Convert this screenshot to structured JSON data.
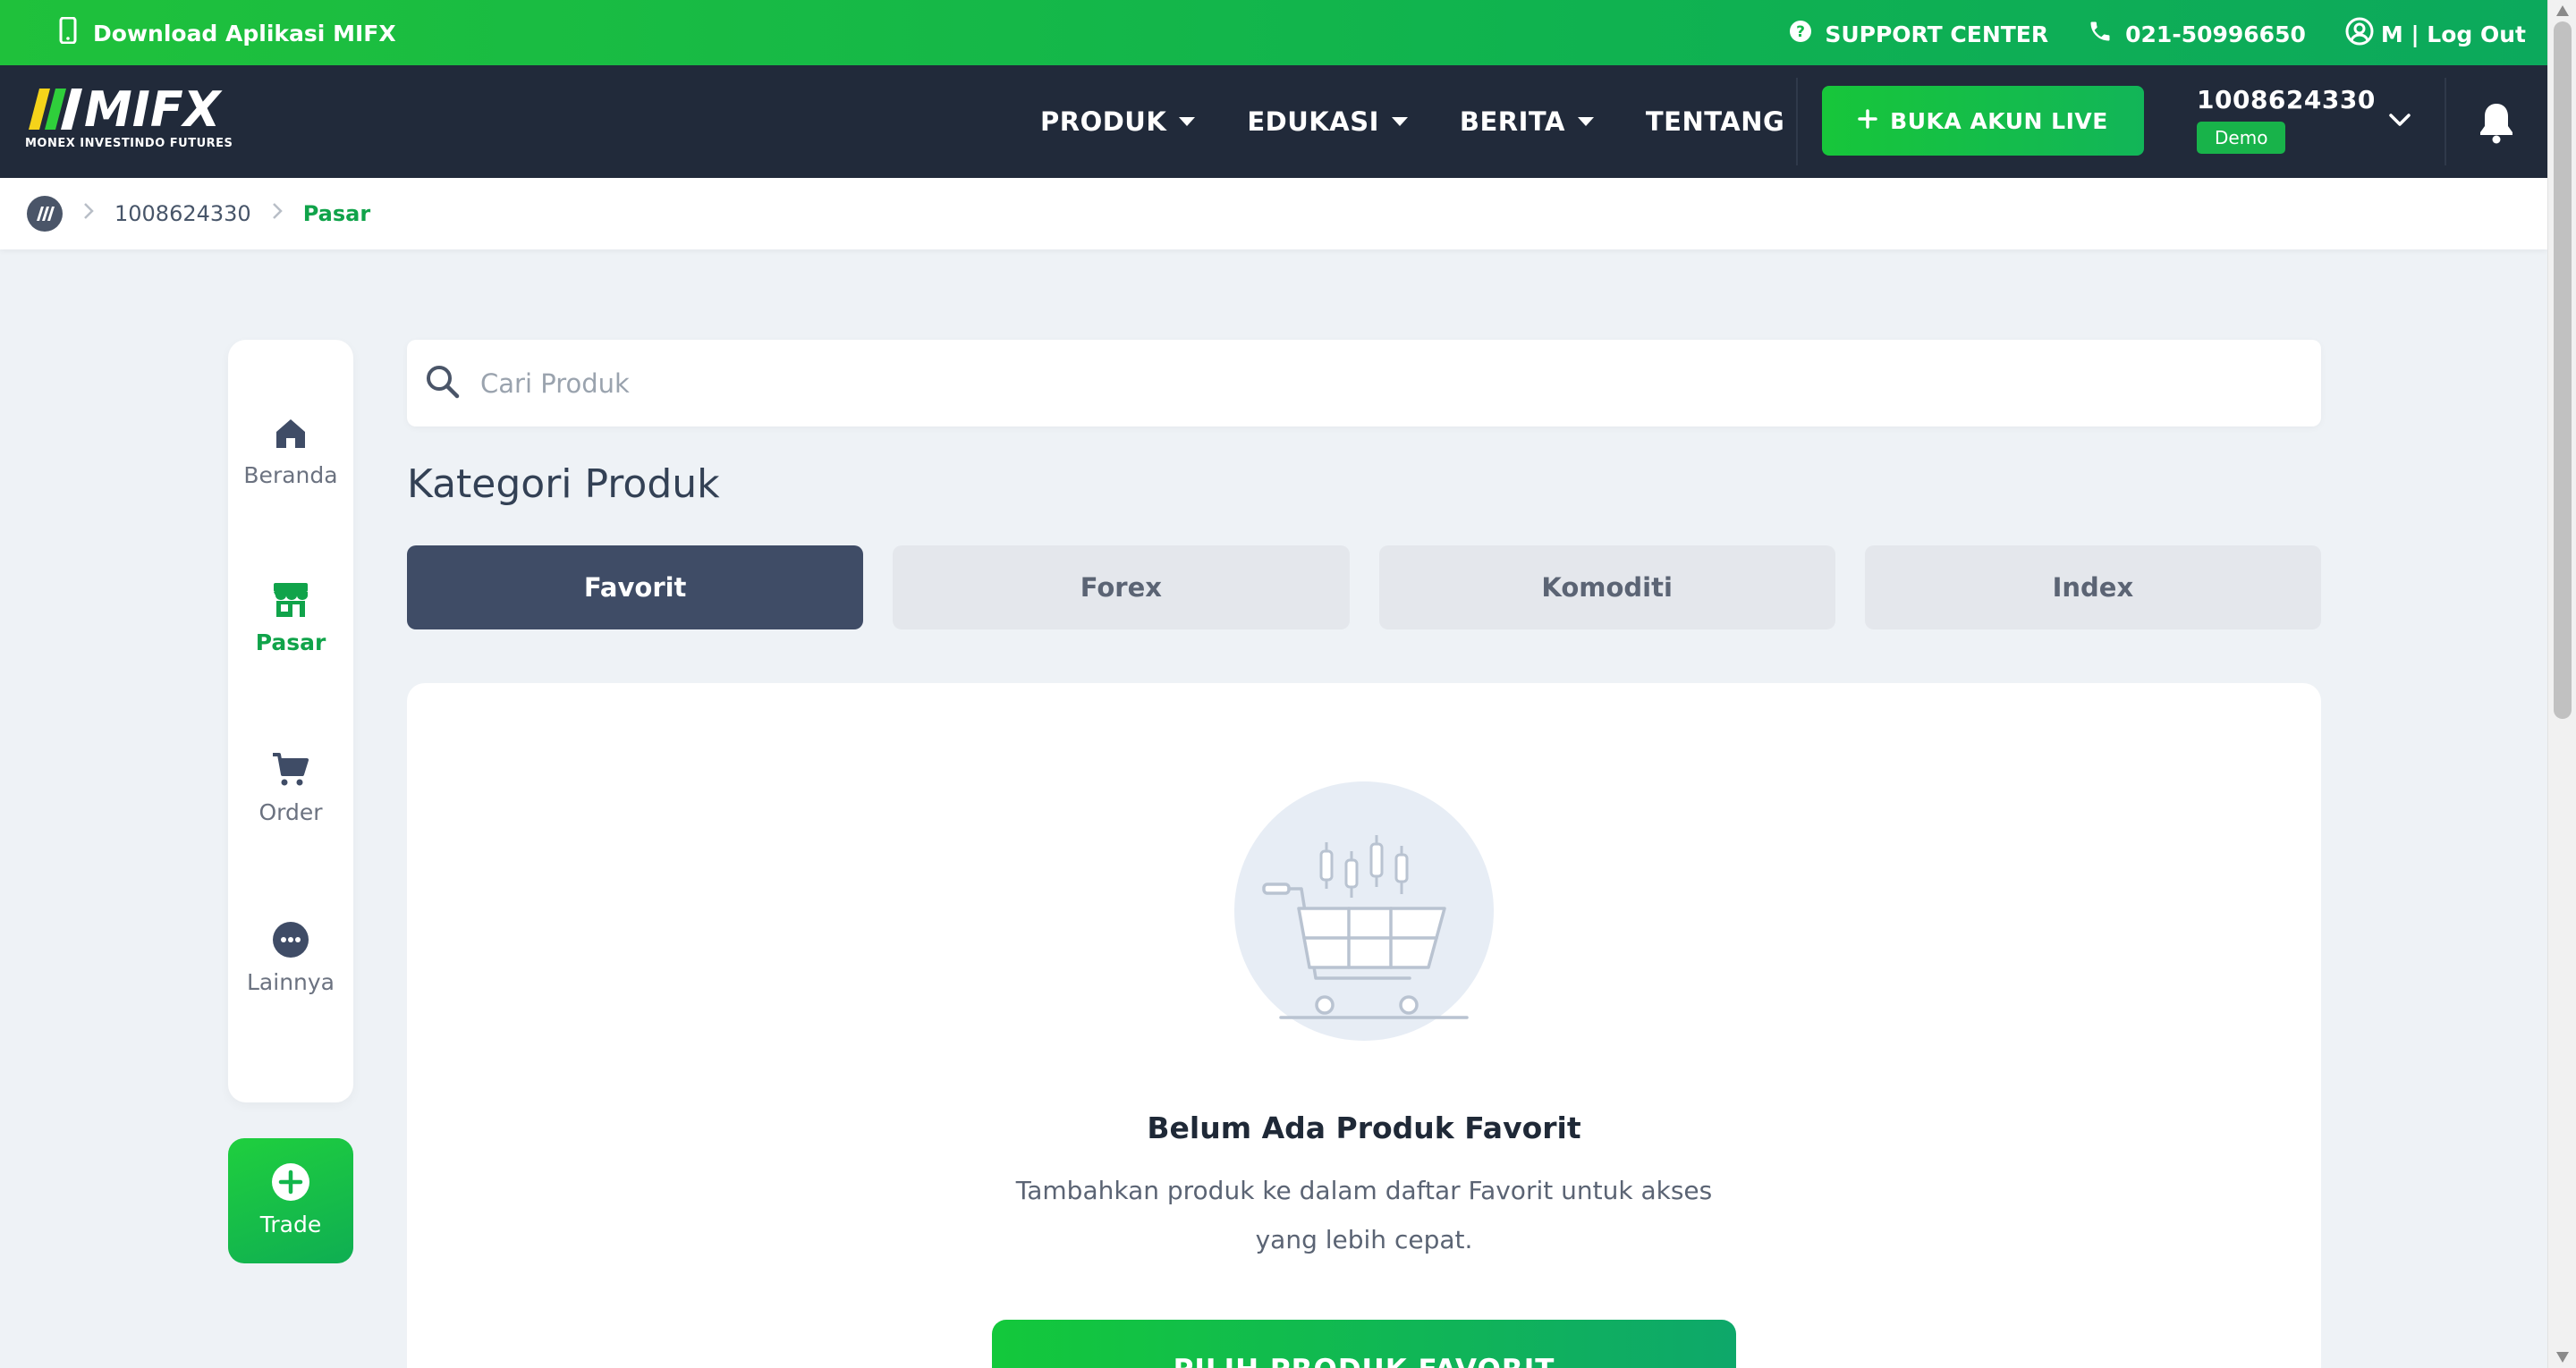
{
  "topbar": {
    "download_label": "Download Aplikasi MIFX",
    "support_label": "SUPPORT CENTER",
    "phone": "021-50996650",
    "user_label": "M | Log Out"
  },
  "navbar": {
    "logo_text": "MIFX",
    "logo_sub": "MONEX INVESTINDO FUTURES",
    "menu": [
      {
        "label": "PRODUK",
        "has_dropdown": true
      },
      {
        "label": "EDUKASI",
        "has_dropdown": true
      },
      {
        "label": "BERITA",
        "has_dropdown": true
      },
      {
        "label": "TENTANG",
        "has_dropdown": false
      }
    ],
    "live_button": "BUKA AKUN LIVE",
    "account_number": "1008624330",
    "account_badge": "Demo"
  },
  "breadcrumb": {
    "items": [
      "1008624330",
      "Pasar"
    ]
  },
  "sidebar": {
    "items": [
      {
        "label": "Beranda",
        "icon": "home-icon",
        "active": false
      },
      {
        "label": "Pasar",
        "icon": "store-icon",
        "active": true
      },
      {
        "label": "Order",
        "icon": "cart-icon",
        "active": false
      },
      {
        "label": "Lainnya",
        "icon": "more-icon",
        "active": false
      }
    ],
    "trade_label": "Trade"
  },
  "main": {
    "search_placeholder": "Cari Produk",
    "title": "Kategori Produk",
    "tabs": [
      "Favorit",
      "Forex",
      "Komoditi",
      "Index"
    ],
    "active_tab": "Favorit",
    "empty_title": "Belum Ada Produk Favorit",
    "empty_desc": "Tambahkan produk ke dalam daftar Favorit untuk akses yang lebih cepat.",
    "cta_label": "PILIH PRODUK FAVORIT"
  },
  "colors": {
    "brand_green": "#12b84a",
    "nav_dark": "#212a3a",
    "tab_active": "#3f4c66"
  }
}
